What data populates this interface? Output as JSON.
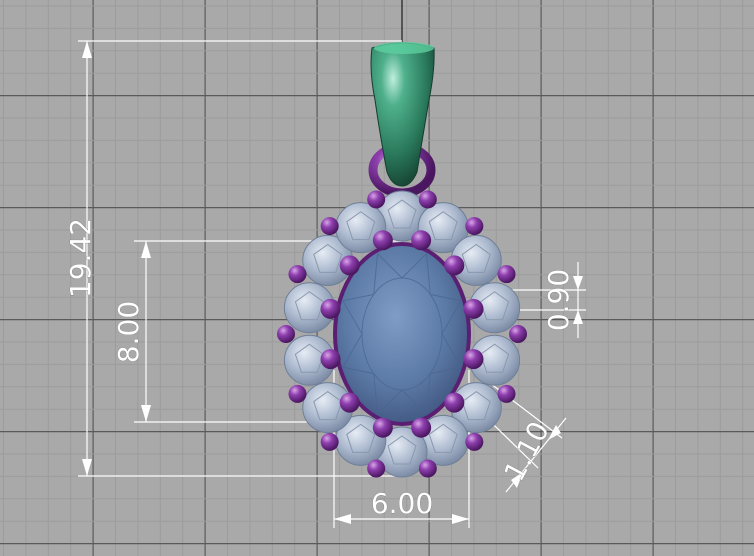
{
  "dimensions": {
    "height_total": "19.42",
    "stone_height": "8.00",
    "stone_width": "6.00",
    "accent_diameter": "0.90",
    "halo_gap": "1.10"
  },
  "colors": {
    "background": "#a9a9a9",
    "grid_minor": "#9c9c9c",
    "grid_major": "#5a5a5a",
    "bail": "#2f8a6a",
    "metal": "#7a2e90",
    "center_stone": "#5f7fa8",
    "halo_stones": "#a9b6c8",
    "dimension_lines": "#ffffff"
  },
  "objects": {
    "bail": "bail",
    "jump_ring": "jump-ring",
    "center_stone": "oval-center-stone",
    "halo": "round-halo-stones",
    "prongs": "prong-balls"
  }
}
